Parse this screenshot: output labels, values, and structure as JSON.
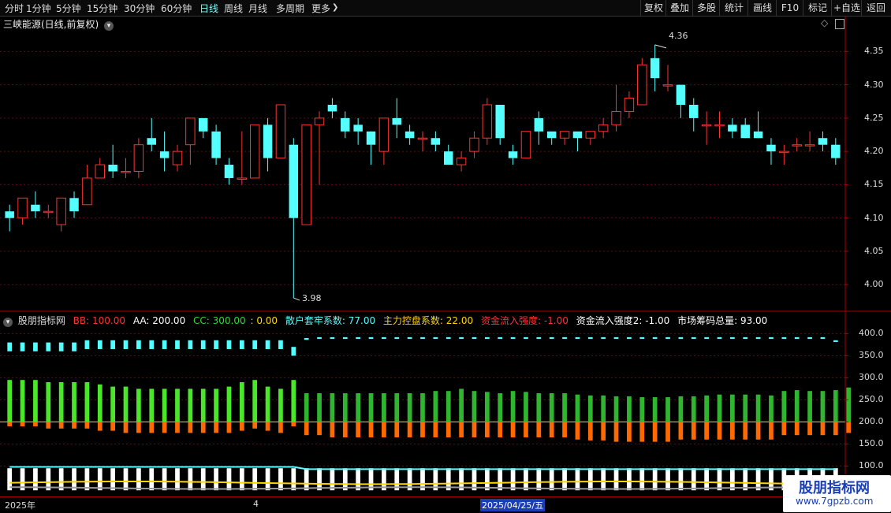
{
  "toolbar": {
    "periods": [
      "分时",
      "1分钟",
      "5分钟",
      "15分钟",
      "30分钟",
      "60分钟",
      "日线",
      "周线",
      "月线",
      "多周期",
      "更多"
    ],
    "more_arrow": "❯",
    "right_buttons": [
      "复权",
      "叠加",
      "多股",
      "统计",
      "画线",
      "F10",
      "标记",
      "+自选",
      "返回"
    ]
  },
  "chart_title": "三峡能源(日线,前复权)",
  "indicator": {
    "name": "股朋指标网",
    "BB": "BB: 100.00",
    "AA": "AA: 200.00",
    "CC": "CC: 300.00",
    "zero": ": 0.00",
    "sanhu": "散户套牢系数: 77.00",
    "zhuli": "主力控盘系数: 22.00",
    "zijin": "资金流入强度: -1.00",
    "zijin2": "资金流入强度2: -1.00",
    "chouma": "市场筹码总量: 93.00"
  },
  "price_axis": [
    "4.35",
    "4.30",
    "4.25",
    "4.20",
    "4.15",
    "4.10",
    "4.05",
    "4.00"
  ],
  "ind_axis": [
    "400.0",
    "350.0",
    "300.0",
    "250.0",
    "200.0",
    "150.0",
    "100.0"
  ],
  "annotations": {
    "high": "4.36",
    "low": "3.98"
  },
  "bottom": {
    "year": "2025年",
    "month": "4",
    "date": "2025/04/25/五"
  },
  "watermark": {
    "line1": "股朋指标网",
    "line2": "www.7gpzb.com"
  },
  "colors": {
    "up": "#ff3232",
    "down": "#54ffff",
    "green": "#2fb52f",
    "orange": "#ff6a00",
    "yellow": "#ffd700"
  },
  "chart_data": {
    "type": "candlestick",
    "ylim": [
      3.96,
      4.38
    ],
    "candles": [
      [
        4.11,
        4.1,
        4.12,
        4.08
      ],
      [
        4.1,
        4.13,
        4.13,
        4.09
      ],
      [
        4.12,
        4.11,
        4.14,
        4.1
      ],
      [
        4.11,
        4.11,
        4.12,
        4.1
      ],
      [
        4.09,
        4.13,
        4.13,
        4.08
      ],
      [
        4.13,
        4.11,
        4.14,
        4.1
      ],
      [
        4.12,
        4.16,
        4.18,
        4.12
      ],
      [
        4.16,
        4.18,
        4.19,
        4.16
      ],
      [
        4.18,
        4.17,
        4.21,
        4.16
      ],
      [
        4.17,
        4.17,
        4.19,
        4.16
      ],
      [
        4.17,
        4.21,
        4.22,
        4.16
      ],
      [
        4.22,
        4.21,
        4.25,
        4.2
      ],
      [
        4.2,
        4.19,
        4.23,
        4.17
      ],
      [
        4.18,
        4.2,
        4.21,
        4.17
      ],
      [
        4.21,
        4.25,
        4.25,
        4.18
      ],
      [
        4.25,
        4.23,
        4.25,
        4.22
      ],
      [
        4.23,
        4.19,
        4.24,
        4.18
      ],
      [
        4.18,
        4.16,
        4.19,
        4.15
      ],
      [
        4.16,
        4.16,
        4.23,
        4.15
      ],
      [
        4.16,
        4.24,
        4.24,
        4.16
      ],
      [
        4.24,
        4.19,
        4.25,
        4.17
      ],
      [
        4.19,
        4.27,
        4.27,
        4.19
      ],
      [
        4.21,
        4.1,
        4.22,
        3.98
      ],
      [
        4.09,
        4.24,
        4.24,
        4.09
      ],
      [
        4.24,
        4.25,
        4.26,
        4.15
      ],
      [
        4.27,
        4.26,
        4.28,
        4.25
      ],
      [
        4.25,
        4.23,
        4.26,
        4.22
      ],
      [
        4.24,
        4.23,
        4.25,
        4.21
      ],
      [
        4.23,
        4.21,
        4.23,
        4.18
      ],
      [
        4.2,
        4.25,
        4.25,
        4.18
      ],
      [
        4.25,
        4.24,
        4.28,
        4.22
      ],
      [
        4.23,
        4.22,
        4.24,
        4.21
      ],
      [
        4.22,
        4.22,
        4.23,
        4.2
      ],
      [
        4.22,
        4.21,
        4.23,
        4.2
      ],
      [
        4.2,
        4.18,
        4.21,
        4.18
      ],
      [
        4.18,
        4.19,
        4.2,
        4.17
      ],
      [
        4.2,
        4.22,
        4.23,
        4.19
      ],
      [
        4.22,
        4.27,
        4.28,
        4.21
      ],
      [
        4.27,
        4.22,
        4.27,
        4.21
      ],
      [
        4.2,
        4.19,
        4.21,
        4.18
      ],
      [
        4.19,
        4.23,
        4.23,
        4.19
      ],
      [
        4.25,
        4.23,
        4.26,
        4.21
      ],
      [
        4.23,
        4.22,
        4.23,
        4.21
      ],
      [
        4.22,
        4.23,
        4.23,
        4.21
      ],
      [
        4.23,
        4.22,
        4.23,
        4.2
      ],
      [
        4.22,
        4.23,
        4.23,
        4.21
      ],
      [
        4.23,
        4.24,
        4.25,
        4.22
      ],
      [
        4.24,
        4.26,
        4.3,
        4.23
      ],
      [
        4.26,
        4.28,
        4.29,
        4.25
      ],
      [
        4.27,
        4.33,
        4.34,
        4.27
      ],
      [
        4.34,
        4.31,
        4.36,
        4.29
      ],
      [
        4.3,
        4.3,
        4.33,
        4.29
      ],
      [
        4.3,
        4.27,
        4.3,
        4.25
      ],
      [
        4.27,
        4.25,
        4.28,
        4.23
      ],
      [
        4.24,
        4.24,
        4.26,
        4.21
      ],
      [
        4.24,
        4.24,
        4.26,
        4.22
      ],
      [
        4.24,
        4.23,
        4.25,
        4.22
      ],
      [
        4.24,
        4.22,
        4.25,
        4.22
      ],
      [
        4.23,
        4.22,
        4.26,
        4.22
      ],
      [
        4.21,
        4.2,
        4.22,
        4.18
      ],
      [
        4.2,
        4.2,
        4.21,
        4.18
      ],
      [
        4.21,
        4.21,
        4.22,
        4.2
      ],
      [
        4.21,
        4.21,
        4.23,
        4.2
      ],
      [
        4.22,
        4.21,
        4.23,
        4.2
      ],
      [
        4.21,
        4.19,
        4.22,
        4.18
      ]
    ],
    "cyan_bars": [
      380,
      380,
      380,
      380,
      380,
      380,
      385,
      385,
      385,
      385,
      385,
      385,
      385,
      385,
      385,
      385,
      385,
      385,
      385,
      385,
      385,
      385,
      370,
      390,
      392,
      392,
      392,
      392,
      392,
      392,
      392,
      392,
      392,
      392,
      392,
      392,
      392,
      392,
      392,
      392,
      392,
      392,
      392,
      392,
      392,
      392,
      392,
      392,
      392,
      392,
      392,
      392,
      392,
      392,
      392,
      392,
      392,
      392,
      392,
      392,
      392,
      392,
      392,
      392,
      385
    ],
    "green_bars": [
      295,
      295,
      295,
      290,
      290,
      290,
      290,
      285,
      280,
      280,
      275,
      275,
      275,
      275,
      275,
      275,
      275,
      280,
      290,
      295,
      280,
      275,
      295,
      265,
      265,
      265,
      265,
      265,
      265,
      265,
      265,
      265,
      265,
      270,
      270,
      275,
      270,
      268,
      265,
      270,
      268,
      265,
      265,
      265,
      262,
      260,
      260,
      258,
      258,
      256,
      256,
      256,
      258,
      258,
      260,
      262,
      262,
      262,
      262,
      260,
      270,
      272,
      270,
      270,
      272,
      278
    ],
    "orange_bars": [
      190,
      190,
      190,
      185,
      185,
      185,
      185,
      180,
      180,
      175,
      175,
      175,
      175,
      175,
      175,
      175,
      175,
      175,
      180,
      185,
      180,
      175,
      190,
      170,
      170,
      165,
      165,
      165,
      165,
      165,
      165,
      165,
      165,
      165,
      165,
      165,
      165,
      165,
      165,
      165,
      165,
      165,
      165,
      165,
      160,
      158,
      158,
      155,
      155,
      155,
      155,
      155,
      160,
      160,
      160,
      160,
      160,
      160,
      160,
      160,
      170,
      170,
      170,
      170,
      170,
      175
    ]
  }
}
